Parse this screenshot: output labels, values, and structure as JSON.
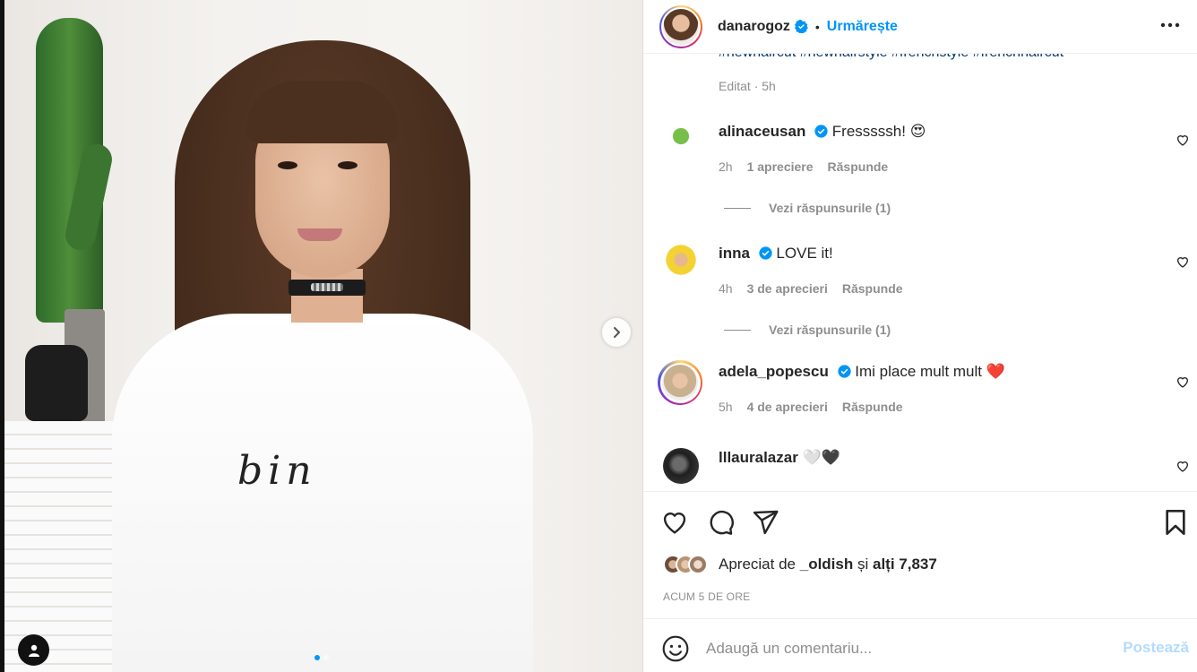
{
  "post": {
    "author": "danarogoz",
    "follow_label": "Urmărește",
    "separator": "•",
    "hashtags": "#newhaircut #newhairstyle #frenchstyle #frenchhaircut",
    "edited_label": "Editat · 5h"
  },
  "media": {
    "shirt_text": "bin",
    "slide_count": 2,
    "active_slide": 1
  },
  "comments": [
    {
      "user": "alinaceusan",
      "text": "Fresssssh! 😍",
      "time": "2h",
      "likes": "1 apreciere",
      "reply": "Răspunde",
      "view_replies": "Vezi răspunsurile (1)"
    },
    {
      "user": "inna",
      "text": "LOVE it!",
      "time": "4h",
      "likes": "3 de aprecieri",
      "reply": "Răspunde",
      "view_replies": "Vezi răspunsurile (1)"
    },
    {
      "user": "adela_popescu",
      "text": "Imi place mult mult ❤️",
      "time": "5h",
      "likes": "4 de aprecieri",
      "reply": "Răspunde"
    },
    {
      "user": "lllauralazar",
      "text": "🤍🖤"
    }
  ],
  "likes": {
    "prefix": "Apreciat de",
    "user": "_oldish",
    "mid": "și",
    "others": "alți 7,837"
  },
  "timestamp": "ACUM 5 DE ORE",
  "composer": {
    "placeholder": "Adaugă un comentariu...",
    "post_label": "Postează"
  },
  "colors": {
    "accent": "#0095f6",
    "link": "#00376b",
    "muted": "#8e8e8e",
    "post_disabled": "#b3dbff"
  }
}
